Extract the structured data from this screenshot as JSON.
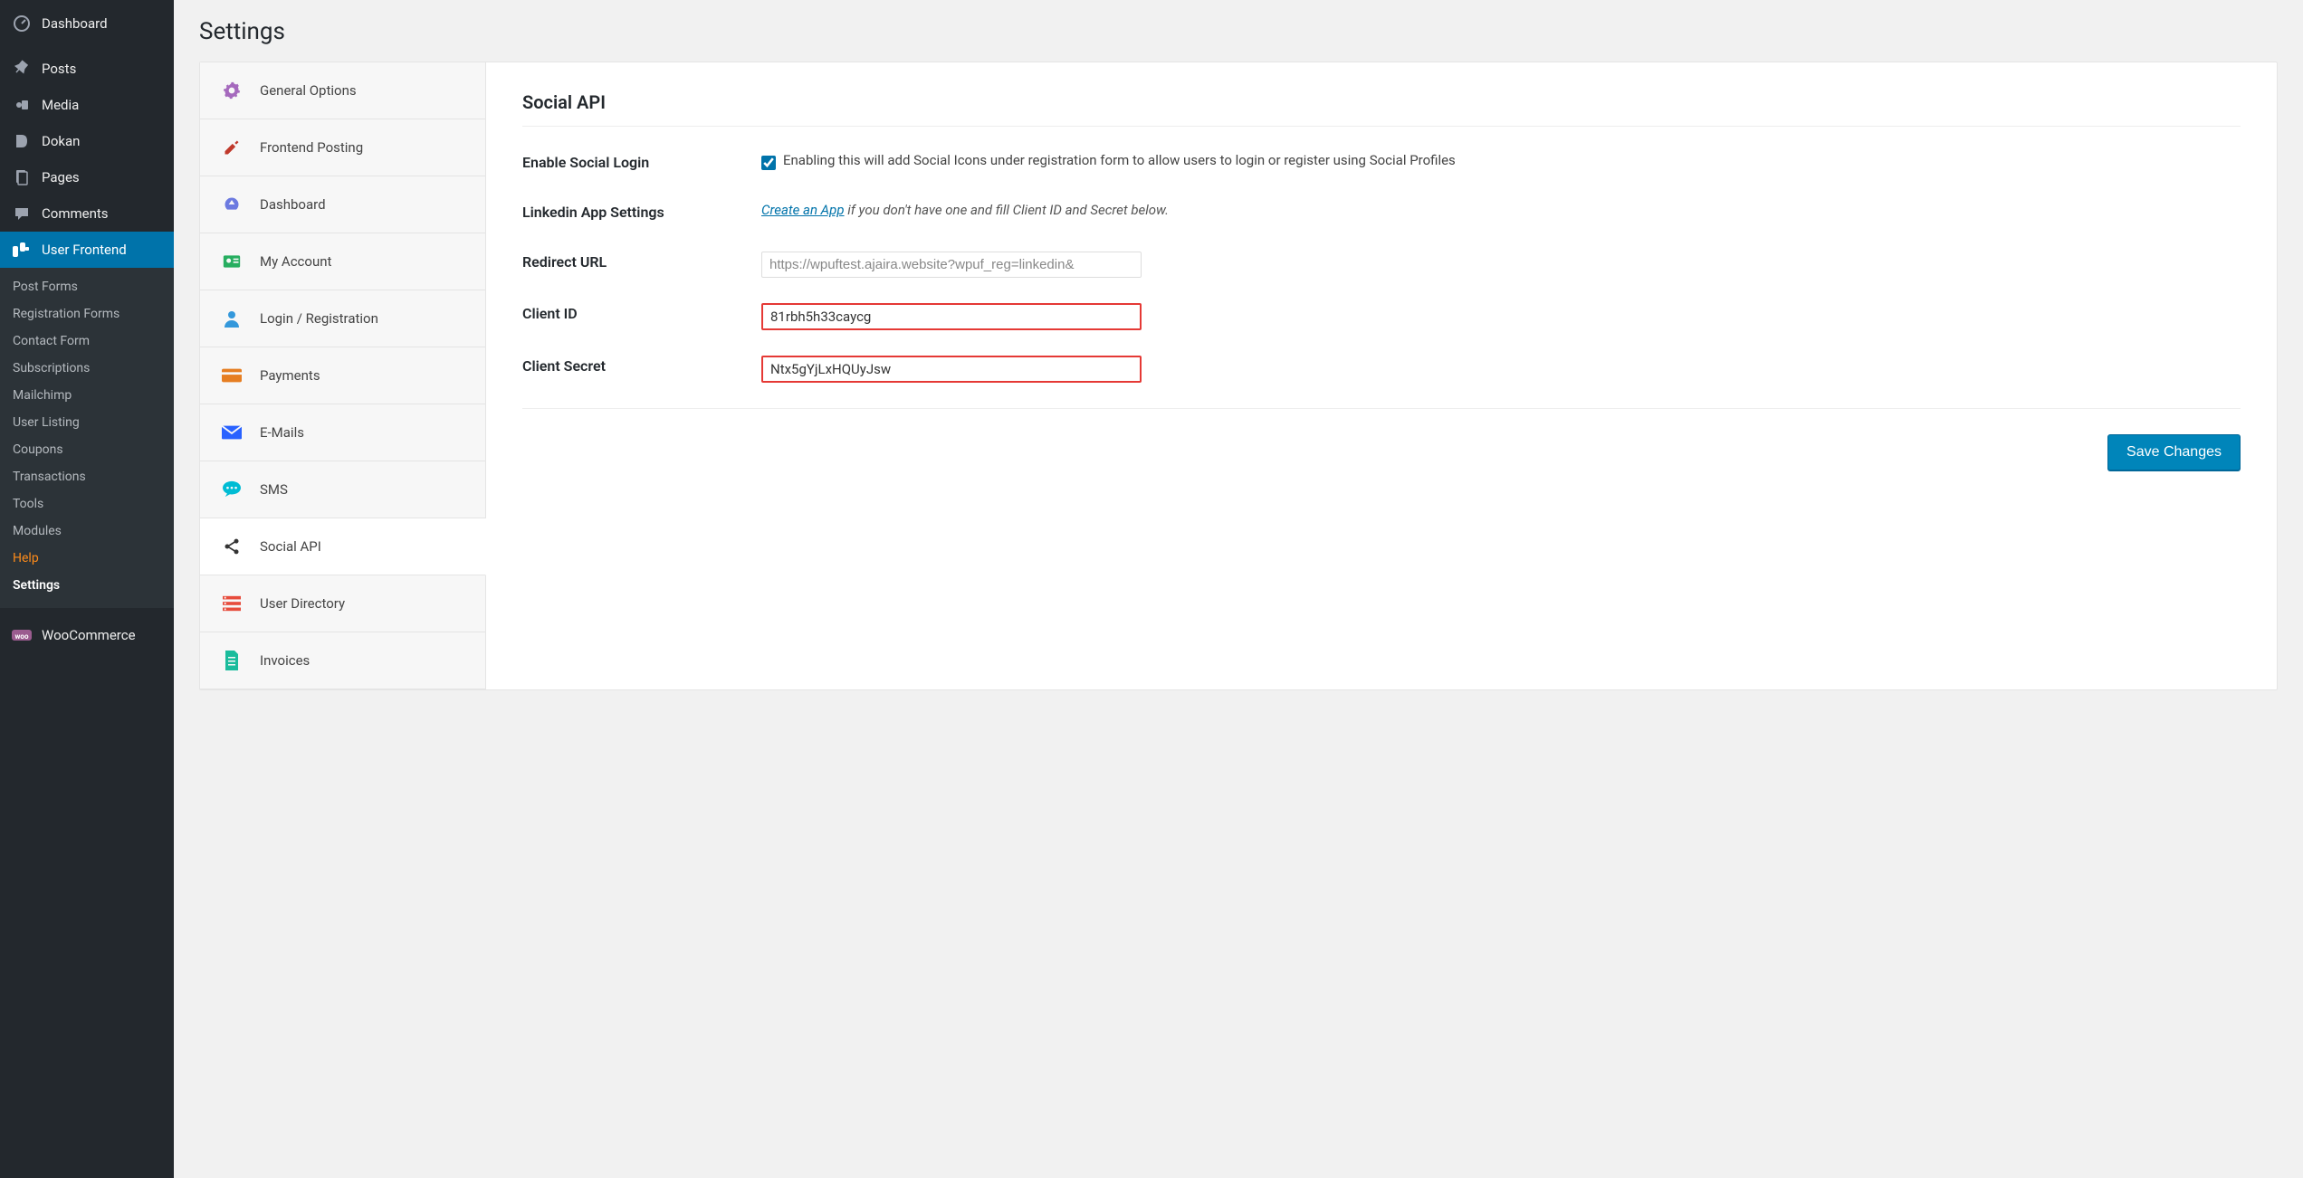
{
  "page_title": "Settings",
  "admin_menu": {
    "dashboard": "Dashboard",
    "posts": "Posts",
    "media": "Media",
    "dokan": "Dokan",
    "pages": "Pages",
    "comments": "Comments",
    "user_frontend": "User Frontend",
    "woocommerce": "WooCommerce"
  },
  "submenu": {
    "post_forms": "Post Forms",
    "registration_forms": "Registration Forms",
    "contact_form": "Contact Form",
    "subscriptions": "Subscriptions",
    "mailchimp": "Mailchimp",
    "user_listing": "User Listing",
    "coupons": "Coupons",
    "transactions": "Transactions",
    "tools": "Tools",
    "modules": "Modules",
    "help": "Help",
    "settings": "Settings"
  },
  "settings_tabs": {
    "general": "General Options",
    "frontend_posting": "Frontend Posting",
    "dashboard": "Dashboard",
    "my_account": "My Account",
    "login_registration": "Login / Registration",
    "payments": "Payments",
    "emails": "E-Mails",
    "sms": "SMS",
    "social_api": "Social API",
    "user_directory": "User Directory",
    "invoices": "Invoices"
  },
  "panel": {
    "heading": "Social API",
    "enable_label": "Enable Social Login",
    "enable_desc": "Enabling this will add Social Icons under registration form to allow users to login or register using Social Profiles",
    "linkedin_label": "Linkedin App Settings",
    "linkedin_link": "Create an App",
    "linkedin_desc": " if you don't have one and fill Client ID and Secret below.",
    "redirect_label": "Redirect URL",
    "redirect_value": "https://wpuftest.ajaira.website?wpuf_reg=linkedin&",
    "client_id_label": "Client ID",
    "client_id_value": "81rbh5h33caycg",
    "client_secret_label": "Client Secret",
    "client_secret_value": "Ntx5gYjLxHQUyJsw",
    "save_button": "Save Changes"
  }
}
